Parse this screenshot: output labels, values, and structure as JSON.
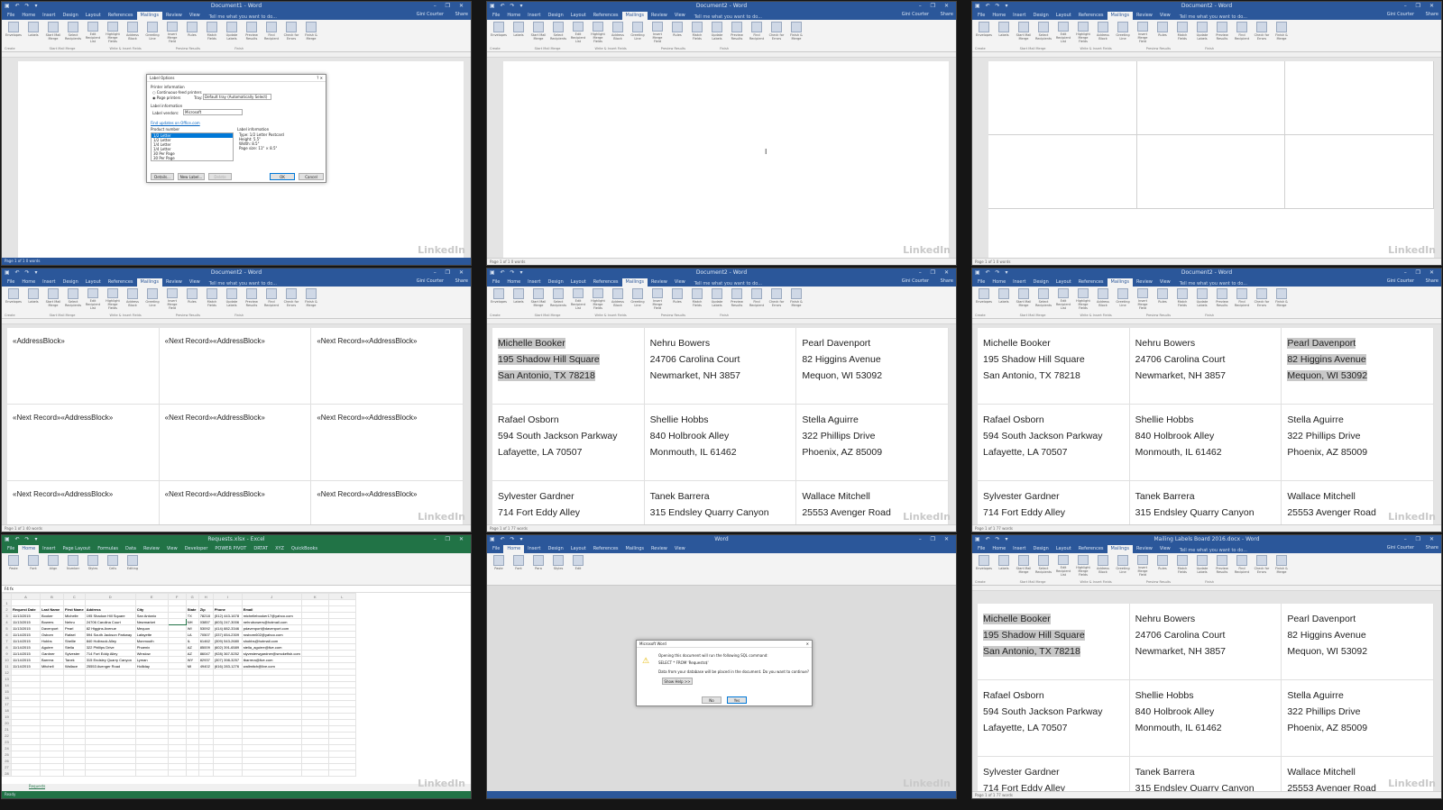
{
  "watermark": "LinkedIn",
  "panes": {
    "p1": {
      "title": "Document1 - Word",
      "tabs": [
        "File",
        "Home",
        "Insert",
        "Design",
        "Layout",
        "References",
        "Mailings",
        "Review",
        "View"
      ],
      "active_tab": "Mailings",
      "tell": "Tell me what you want to do...",
      "user": "Gini Courter",
      "share": "Share",
      "ribbon": [
        "Envelopes",
        "Labels",
        "Start Mail Merge",
        "Select Recipients",
        "Edit Recipient List",
        "Highlight Merge Fields",
        "Address Block",
        "Greeting Line",
        "Insert Merge Field",
        "Rules",
        "Match Fields",
        "Update Labels",
        "Preview Results",
        "Find Recipient",
        "Check for Errors",
        "Finish & Merge"
      ],
      "groups": [
        "Create",
        "Start Mail Merge",
        "Write & Insert Fields",
        "Preview Results",
        "Finish"
      ],
      "status": "Page 1 of 1   0 words",
      "dialog": {
        "title": "Label Options",
        "printer_info": "Printer information",
        "continuous": "Continuous-feed printers",
        "page": "Page printers",
        "tray_label": "Tray:",
        "tray": "Default tray (Automatically Select)",
        "label_info": "Label information",
        "vendors_label": "Label vendors:",
        "vendor": "Microsoft",
        "find_updates": "Find updates on Office.com",
        "product_number": "Product number",
        "products": [
          "1/2 Letter",
          "1/2 Letter",
          "1/4 Letter",
          "1/4 Letter",
          "30 Per Page",
          "30 Per Page"
        ],
        "label_information": "Label information",
        "type": "Type:   1/2 Letter Postcard",
        "height": "Height:   5.5\"",
        "width": "Width:   8.5\"",
        "page_size": "Page size:   11\" × 8.5\"",
        "details": "Details...",
        "new_label": "New Label...",
        "delete": "Delete",
        "ok": "OK",
        "cancel": "Cancel"
      }
    },
    "p2": {
      "title": "Document2 - Word",
      "context": "Table Tools",
      "status": "Page 1 of 1   0 words"
    },
    "p3": {
      "title": "Document2 - Word",
      "context": "Table Tools",
      "status": "Page 1 of 1   0 words"
    },
    "p4": {
      "title": "Document2 - Word",
      "context": "Table Tools",
      "status": "Page 1 of 1   40 words",
      "cells": [
        "«AddressBlock»",
        "«Next Record»«AddressBlock»",
        "«Next Record»«AddressBlock»",
        "«Next Record»«AddressBlock»",
        "«Next Record»«AddressBlock»",
        "«Next Record»«AddressBlock»",
        "«Next Record»«AddressBlock»",
        "«Next Record»«AddressBlock»",
        "«Next Record»«AddressBlock»"
      ]
    },
    "labels": {
      "status": "Page 1 of 1   77 words",
      "rows": [
        [
          [
            "Michelle Booker",
            "195 Shadow Hill Square",
            "San Antonio, TX 78218"
          ],
          [
            "Nehru Bowers",
            "24706 Carolina Court",
            "Newmarket, NH 3857"
          ],
          [
            "Pearl Davenport",
            "82 Higgins Avenue",
            "Mequon, WI 53092"
          ]
        ],
        [
          [
            "Rafael Osborn",
            "594 South Jackson Parkway",
            "Lafayette, LA 70507"
          ],
          [
            "Shellie Hobbs",
            "840 Holbrook Alley",
            "Monmouth, IL 61462"
          ],
          [
            "Stella Aguirre",
            "322 Phillips Drive",
            "Phoenix, AZ 85009"
          ]
        ],
        [
          [
            "Sylvester Gardner",
            "714 Fort Eddy Alley",
            ""
          ],
          [
            "Tanek Barrera",
            "315 Endsley Quarry Canyon",
            ""
          ],
          [
            "Wallace Mitchell",
            "25553 Avenger Road",
            ""
          ]
        ]
      ]
    },
    "p7": {
      "title": "Requests.xlsx - Excel",
      "tabs": [
        "File",
        "Home",
        "Insert",
        "Page Layout",
        "Formulas",
        "Data",
        "Review",
        "View",
        "Developer",
        "POWER PIVOT",
        "DRTAT",
        "XYZ",
        "QuickBooks"
      ],
      "active_tab": "Home",
      "namebox": "F4",
      "sheet_tab": "Requests",
      "status": "Ready",
      "columns": [
        "",
        "A",
        "B",
        "C",
        "D",
        "E",
        "F",
        "G",
        "H",
        "I",
        "J",
        "K",
        "L"
      ],
      "headers": [
        "Request Date",
        "Last Name",
        "First Name",
        "Address",
        "City",
        "",
        "State",
        "Zip",
        "Phone",
        "Email"
      ],
      "rows": [
        [
          "11/13/2015",
          "Booker",
          "Michelle",
          "195 Shadow Hill Square",
          "San Antonio",
          "",
          "TX",
          "78218",
          "(512) 443-1678",
          "michellebooker17@yahoo.com"
        ],
        [
          "11/13/2015",
          "Bowers",
          "Nehru",
          "24706 Carolina Court",
          "Newmarket",
          "",
          "NH",
          "03857",
          "(603) 247-3006",
          "nehrubowers@hotmail.com"
        ],
        [
          "11/13/2015",
          "Davenport",
          "Pearl",
          "82 Higgins Avenue",
          "Mequon",
          "",
          "WI",
          "53092",
          "(414) 882-3346",
          "pdavenport@davenport.com"
        ],
        [
          "11/14/2015",
          "Osborn",
          "Rafael",
          "594 South Jackson Parkway",
          "Lafayette",
          "",
          "LA",
          "70507",
          "(337) 654-2309",
          "rosborn602@yahoo.com"
        ],
        [
          "11/14/2015",
          "Hobbs",
          "Shellie",
          "840 Holbrook Alley",
          "Monmouth",
          "",
          "IL",
          "61462",
          "(309) 543-2680",
          "shobbs@hotmail.com"
        ],
        [
          "11/14/2015",
          "Aguirre",
          "Stella",
          "322 Phillips Drive",
          "Phoenix",
          "",
          "AZ",
          "85009",
          "(602) 391-6589",
          "stella_aguirre@live.com"
        ],
        [
          "11/14/2015",
          "Gardner",
          "Sylvester",
          "714 Fort Eddy Alley",
          "Winslow",
          "",
          "AZ",
          "86047",
          "(928) 367-5252",
          "slyvesterwgardner@smokefish.com"
        ],
        [
          "11/14/2015",
          "Barrera",
          "Tanek",
          "315 Endsley Quarry Canyon",
          "Lyman",
          "",
          "WY",
          "82937",
          "(307) 398-3257",
          "tbarrera@live.com"
        ],
        [
          "11/14/2015",
          "Mitchell",
          "Wallace",
          "25553 Avenger Road",
          "Holliday",
          "",
          "MI",
          "49402",
          "(616) 283-1276",
          "wallmitch@live.com"
        ]
      ]
    },
    "p8": {
      "title": "Word",
      "tabs": [
        "File",
        "Home",
        "Insert",
        "Design",
        "Layout",
        "References",
        "Mailings",
        "Review",
        "View"
      ],
      "active_tab": "Home",
      "status": "",
      "dialog": {
        "title": "Microsoft Word",
        "line1": "Opening this document will run the following SQL command:",
        "line2": "SELECT * FROM 'Requests$'",
        "line3": "Data from your database will be placed in the document. Do you want to continue?",
        "show_help": "Show Help >>",
        "no": "No",
        "yes": "Yes"
      }
    },
    "p9": {
      "title": "Mailing Labels Board 2016.docx - Word",
      "context": "Table Tools",
      "status": "Page 1 of 1   77 words"
    },
    "labels_context": "Table Tools"
  }
}
